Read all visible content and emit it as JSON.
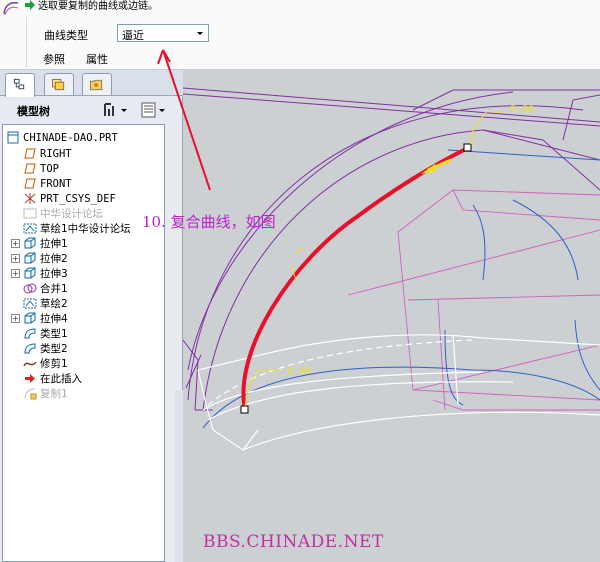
{
  "dashboard": {
    "prompt": "选取要复制的曲线或边链。",
    "curve_type_label": "曲线类型",
    "curve_type_value": "逼近",
    "tabs": {
      "reference": "参照",
      "properties": "属性"
    }
  },
  "navigator": {
    "title": "模型树",
    "root": "CHINADE-DAO.PRT",
    "items": [
      {
        "label": "RIGHT"
      },
      {
        "label": "TOP"
      },
      {
        "label": "FRONT"
      },
      {
        "label": "PRT_CSYS_DEF"
      },
      {
        "label": "中华设计论坛"
      },
      {
        "label": "草绘1中华设计论坛"
      },
      {
        "label": "拉伸1"
      },
      {
        "label": "拉伸2"
      },
      {
        "label": "拉伸3"
      },
      {
        "label": "合并1"
      },
      {
        "label": "草绘2"
      },
      {
        "label": "拉伸4"
      },
      {
        "label": "类型1"
      },
      {
        "label": "类型2"
      },
      {
        "label": "修剪1"
      },
      {
        "label": "在此插入"
      },
      {
        "label": "复制1"
      }
    ]
  },
  "graphics": {
    "dim_top": "0.00",
    "dim_bottom": "0.00"
  },
  "annotation": "10. 复合曲线，如图",
  "watermark": "BBS.CHINADE.NET",
  "colors": {
    "accent_red": "#e8102a",
    "annotation_magenta": "#c020d0",
    "curve_purple": "#8030a0",
    "dim_yellow": "#f0e020"
  },
  "icons": [
    "copy-curve-icon",
    "green-arrow-icon",
    "dropdown-arrow-icon",
    "model-tree-icon",
    "layer-icon",
    "folder-icon",
    "tree-settings-icon",
    "show-icon"
  ]
}
